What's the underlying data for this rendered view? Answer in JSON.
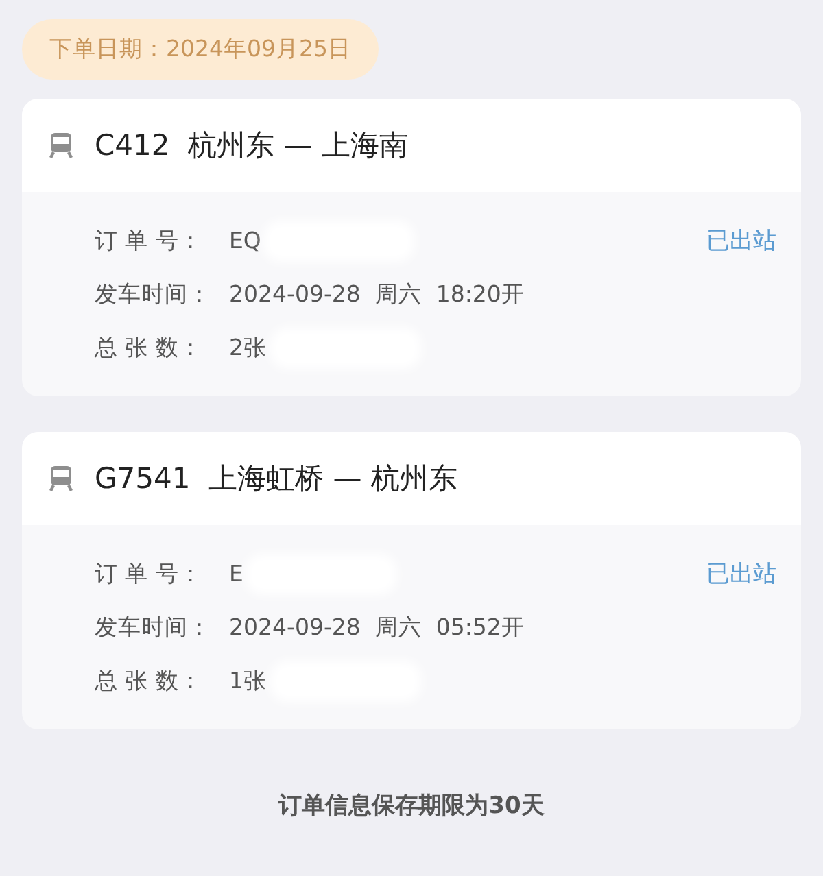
{
  "order_date": {
    "label": "下单日期：",
    "value": "2024年09月25日"
  },
  "orders": [
    {
      "train": "C412",
      "route": "杭州东 — 上海南",
      "status": "已出站",
      "rows": [
        {
          "label": "订 单 号：",
          "value": "EQ",
          "redacted": true
        },
        {
          "label": "发车时间：",
          "value": "2024-09-28  周六  18:20开",
          "redacted": false
        },
        {
          "label": "总 张 数：",
          "value": "2张",
          "redacted": true
        }
      ]
    },
    {
      "train": "G7541",
      "route": "上海虹桥 — 杭州东",
      "status": "已出站",
      "rows": [
        {
          "label": "订 单 号：",
          "value": "E",
          "redacted": true
        },
        {
          "label": "发车时间：",
          "value": "2024-09-28  周六  05:52开",
          "redacted": false
        },
        {
          "label": "总 张 数：",
          "value": "1张",
          "redacted": true
        }
      ]
    }
  ],
  "footer": "订单信息保存期限为30天"
}
